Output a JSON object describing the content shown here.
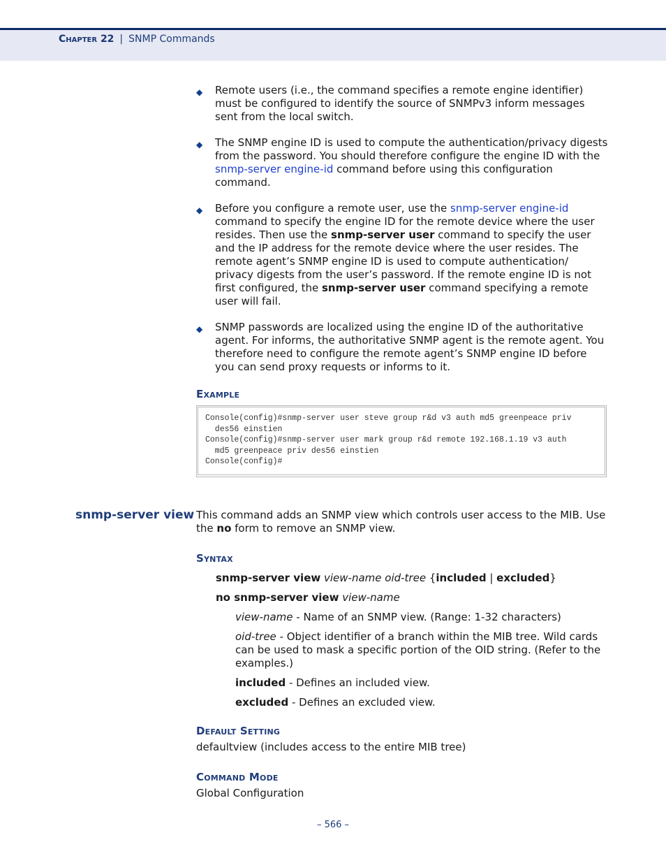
{
  "header": {
    "chapter": "Chapter 22",
    "separator": "|",
    "title": "SNMP Commands"
  },
  "bullets": [
    {
      "text_parts": [
        {
          "t": "Remote users (i.e., the command specifies a remote engine identifier) must be configured to identify the source of SNMPv3 inform messages sent from the local switch.",
          "style": "normal"
        }
      ]
    },
    {
      "text_parts": [
        {
          "t": "The SNMP engine ID is used to compute the authentication/privacy digests from the password. You should therefore configure the engine ID with the ",
          "style": "normal"
        },
        {
          "t": "snmp-server engine-id",
          "style": "link"
        },
        {
          "t": " command before using this configuration command.",
          "style": "normal"
        }
      ]
    },
    {
      "text_parts": [
        {
          "t": "Before you configure a remote user, use the ",
          "style": "normal"
        },
        {
          "t": "snmp-server engine-id",
          "style": "link"
        },
        {
          "t": " command to specify the engine ID for the remote device where the user resides. Then use the ",
          "style": "normal"
        },
        {
          "t": "snmp-server user",
          "style": "bold"
        },
        {
          "t": " command to specify the user and the IP address for the remote device where the user resides. The remote agent’s SNMP engine ID is used to compute authentication/ privacy digests from the user’s password. If the remote engine ID is not first configured, the ",
          "style": "normal"
        },
        {
          "t": "snmp-server user",
          "style": "bold"
        },
        {
          "t": " command specifying a remote user will fail.",
          "style": "normal"
        }
      ]
    },
    {
      "text_parts": [
        {
          "t": "SNMP passwords are localized using the engine ID of the authoritative agent. For informs, the authoritative SNMP agent is the remote agent. You therefore need to configure the remote agent’s SNMP engine ID before you can send proxy requests or informs to it.",
          "style": "normal"
        }
      ]
    }
  ],
  "example": {
    "heading": "Example",
    "code_lines": [
      "Console(config)#snmp-server user steve group r&d v3 auth md5 greenpeace priv",
      "  des56 einstien",
      "Console(config)#snmp-server user mark group r&d remote 192.168.1.19 v3 auth",
      "  md5 greenpeace priv des56 einstien",
      "Console(config)#"
    ]
  },
  "command": {
    "name": "snmp-server view",
    "desc_part1": "This command adds an SNMP view which controls user access to the MIB. Use the ",
    "desc_bold": "no",
    "desc_part2": " form to remove an SNMP view."
  },
  "syntax": {
    "heading": "Syntax",
    "line1_bold": "snmp-server view",
    "line1_italic": " view-name oid-tree ",
    "line1_brace_open": "{",
    "line1_opt1": "included",
    "line1_pipe": " | ",
    "line1_opt2": "excluded",
    "line1_brace_close": "}",
    "line2_bold": "no snmp-server view",
    "line2_italic": " view-name",
    "params": [
      {
        "name": "view-name",
        "style": "italic",
        "desc": " - Name of an SNMP view. (Range: 1-32 characters)"
      },
      {
        "name": "oid-tree",
        "style": "italic",
        "desc": " - Object identifier of a branch within the MIB tree. Wild cards can be used to mask a specific portion of the OID string. (Refer to the examples.)"
      },
      {
        "name": "included",
        "style": "bold",
        "desc": " - Defines an included view."
      },
      {
        "name": "excluded",
        "style": "bold",
        "desc": " - Defines an excluded view."
      }
    ]
  },
  "default_setting": {
    "heading": "Default Setting",
    "value": "defaultview (includes access to the entire MIB tree)"
  },
  "command_mode": {
    "heading": "Command Mode",
    "value": "Global Configuration"
  },
  "page_number": "–  566  –"
}
